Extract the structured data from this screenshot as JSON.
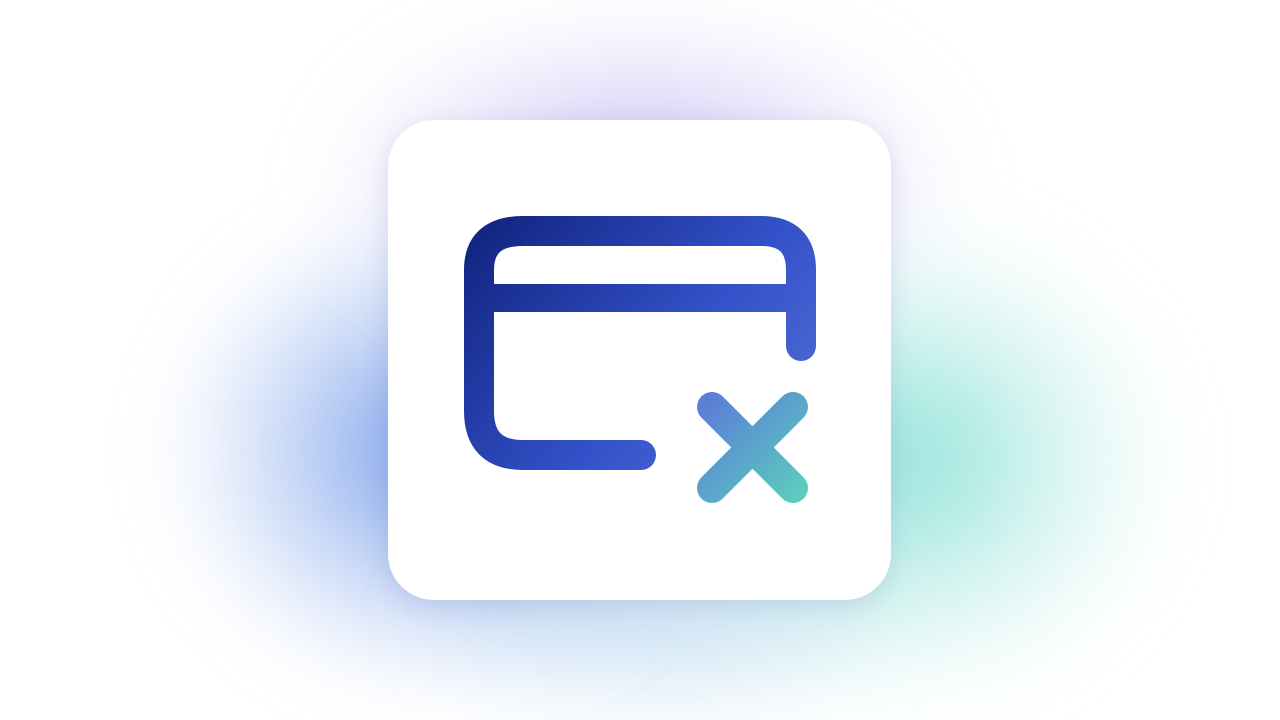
{
  "icon": {
    "name": "credit-card-x-icon",
    "gradient_start": "#10237f",
    "gradient_mid": "#3452c9",
    "gradient_end": "#5ccbbd"
  },
  "colors": {
    "glow_purple": "#9682e6",
    "glow_blue": "#4678e1",
    "glow_teal": "#50d2c3",
    "tile": "#ffffff"
  }
}
